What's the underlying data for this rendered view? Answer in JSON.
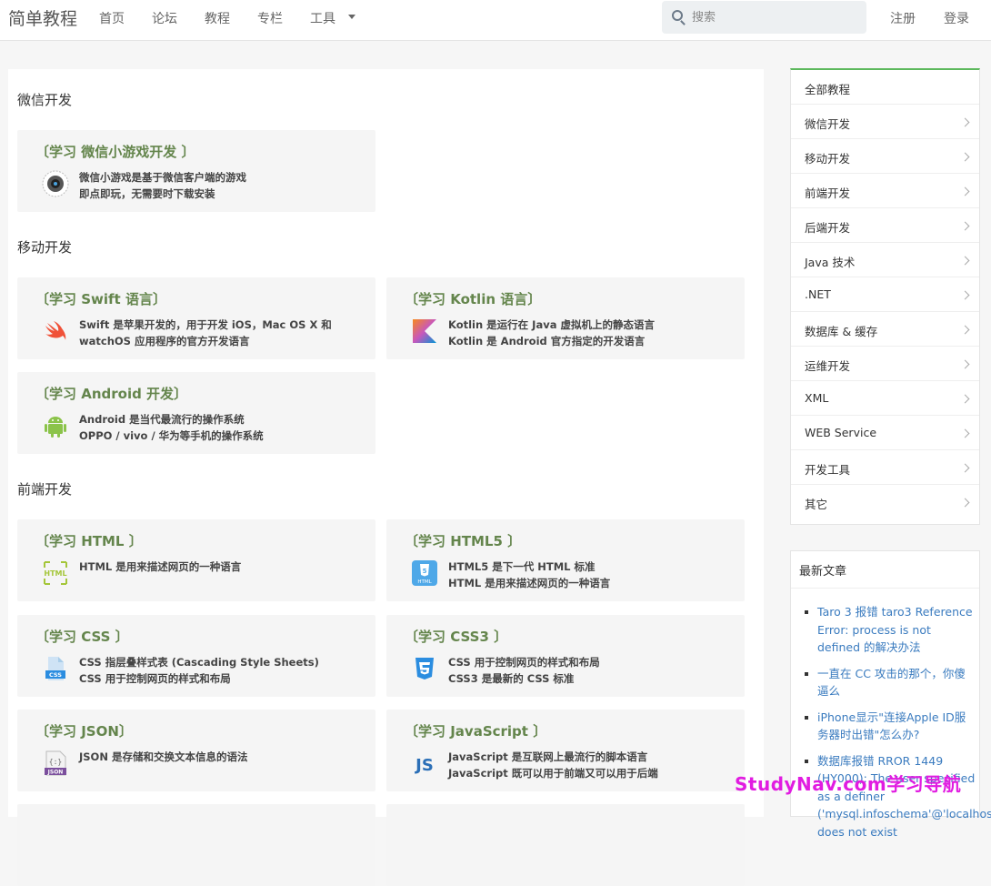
{
  "header": {
    "brand": "简单教程",
    "nav": [
      "首页",
      "论坛",
      "教程",
      "专栏",
      "工具"
    ],
    "search_placeholder": "搜索",
    "register": "注册",
    "login": "登录"
  },
  "sections": [
    {
      "title": "微信开发"
    },
    {
      "title": "移动开发"
    },
    {
      "title": "前端开发"
    }
  ],
  "cards": [
    {
      "title": "〔学习 微信小游戏开发 〕",
      "d1": "微信小游戏是基于微信客户端的游戏",
      "d2": "即点即玩，无需要时下载安装",
      "icon": "wechat-minigame-icon"
    },
    {
      "title": "〔学习 Swift 语言〕",
      "d1": "Swift 是苹果开发的，用于开发 iOS，Mac OS X 和",
      "d2": "watchOS 应用程序的官方开发语言",
      "icon": "swift-icon"
    },
    {
      "title": "〔学习 Kotlin 语言〕",
      "d1": "Kotlin 是运行在 Java 虚拟机上的静态语言",
      "d2": "Kotlin 是 Android 官方指定的开发语言",
      "icon": "kotlin-icon"
    },
    {
      "title": "〔学习 Android 开发〕",
      "d1": "Android 是当代最流行的操作系统",
      "d2": "OPPO / vivo / 华为等手机的操作系统",
      "icon": "android-icon"
    },
    {
      "title": "〔学习 HTML 〕",
      "d1": "HTML 是用来描述网页的一种语言",
      "d2": "",
      "icon": "html-icon"
    },
    {
      "title": "〔学习 HTML5 〕",
      "d1": "HTML5 是下一代 HTML 标准",
      "d2": "HTML 是用来描述网页的一种语言",
      "icon": "html5-icon"
    },
    {
      "title": "〔学习 CSS 〕",
      "d1": "CSS 指层叠样式表 (Cascading Style Sheets)",
      "d2": "CSS 用于控制网页的样式和布局",
      "icon": "css-icon"
    },
    {
      "title": "〔学习 CSS3 〕",
      "d1": "CSS 用于控制网页的样式和布局",
      "d2": "CSS3 是最新的 CSS 标准",
      "icon": "css3-icon"
    },
    {
      "title": "〔学习 JSON〕",
      "d1": "JSON 是存储和交换文本信息的语法",
      "d2": "",
      "icon": "json-icon"
    },
    {
      "title": "〔学习 JavaScript 〕",
      "d1": "JavaScript 是互联网上最流行的脚本语言",
      "d2": "JavaScript 既可以用于前端又可以用于后端",
      "icon": "javascript-icon"
    }
  ],
  "sidebar": {
    "items": [
      "全部教程",
      "微信开发",
      "移动开发",
      "前端开发",
      "后端开发",
      "Java 技术",
      ".NET",
      "数据库 & 缓存",
      "运维开发",
      "XML",
      "WEB Service",
      "开发工具",
      "其它"
    ]
  },
  "news": {
    "title": "最新文章",
    "items": [
      "Taro 3 报错 taro3 Reference Error: process is not defined 的解决办法",
      "一直在 CC 攻击的那个，你傻逼么",
      "iPhone显示\"连接Apple ID服务器时出错\"怎么办?",
      "数据库报错 RROR 1449 (HY000): The user specified as a definer ('mysql.infoschema'@'localhost') does not exist"
    ]
  },
  "watermark": "StudyNav.com学习导航",
  "colors": {
    "accent": "#5cb85c",
    "card_title": "#64854c",
    "link": "#3a7bbf"
  }
}
